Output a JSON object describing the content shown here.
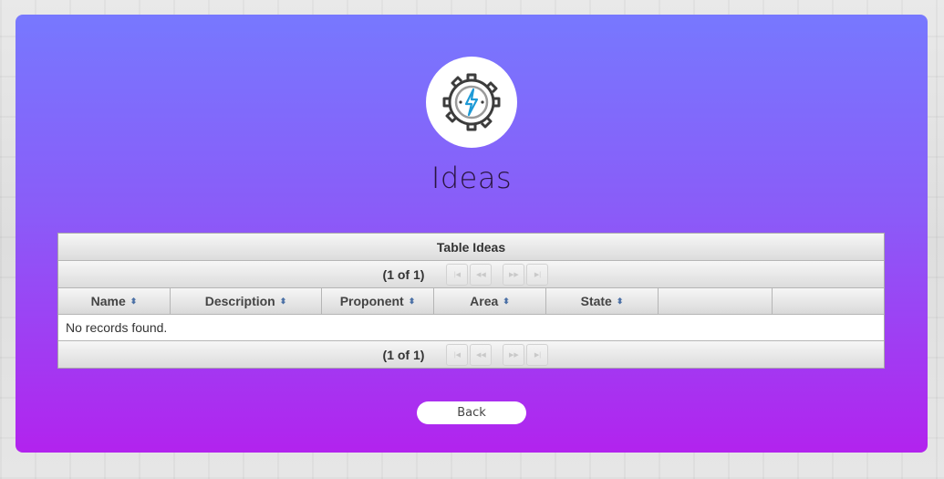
{
  "page": {
    "title": "Ideas",
    "logo_icon": "gear-lightning-icon",
    "accent_gradient": [
      "#7778fe",
      "#b223ee"
    ]
  },
  "table": {
    "caption": "Table Ideas",
    "paginator_text": "(1 of 1)",
    "columns": [
      "Name",
      "Description",
      "Proponent",
      "Area",
      "State",
      "",
      ""
    ],
    "empty_message": "No records found."
  },
  "actions": {
    "back_label": "Back"
  }
}
